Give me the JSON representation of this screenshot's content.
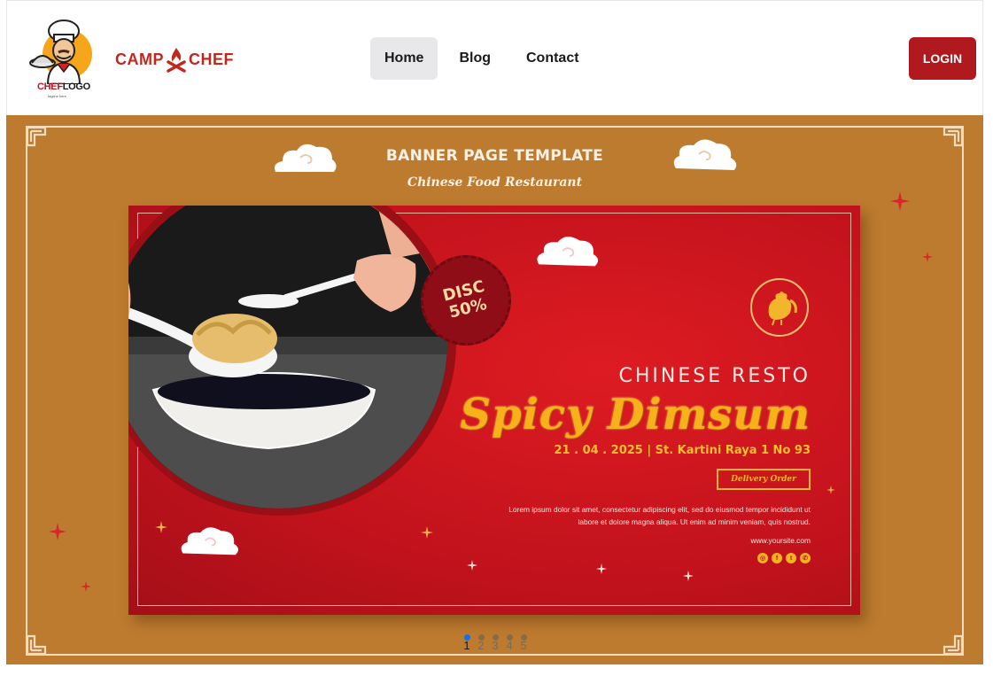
{
  "header": {
    "chef_logo": {
      "word1": "CHEF",
      "word2": "LOGO",
      "tagline": "tagline here"
    },
    "camp_logo": {
      "word1": "CAMP",
      "word2": "CHEF"
    },
    "nav": [
      {
        "label": "Home",
        "active": true
      },
      {
        "label": "Blog",
        "active": false
      },
      {
        "label": "Contact",
        "active": false
      }
    ],
    "login_label": "LOGIN"
  },
  "banner": {
    "title": "BANNER PAGE TEMPLATE",
    "subtitle": "Chinese Food Restaurant",
    "card": {
      "disc_line1": "DISC",
      "disc_line2": "50%",
      "resto": "CHINESE RESTO",
      "headline": "Spicy Dimsum",
      "date_place": "21 . 04 . 2025 | St. Kartini Raya 1 No 93",
      "cta": "Delivery Order",
      "lorem": "Lorem ipsum dolor sit amet, consectetur adipiscing elit, sed do eiusmod tempor incididunt ut labore et dolore magna aliqua. Ut enim ad minim veniam, quis nostrud.",
      "website": "www.yoursite.com",
      "socials": [
        "instagram",
        "facebook",
        "twitter",
        "whatsapp"
      ]
    },
    "carousel": {
      "pages": [
        "1",
        "2",
        "3",
        "4",
        "5"
      ],
      "active_index": 0
    }
  },
  "colors": {
    "brand_red": "#b0191e",
    "banner_bg": "#bd7b2f",
    "card_red": "#c1121c",
    "gold": "#f7b21a",
    "nav_active_bg": "#e8e8ea",
    "carousel_active": "#1a6fe0"
  }
}
